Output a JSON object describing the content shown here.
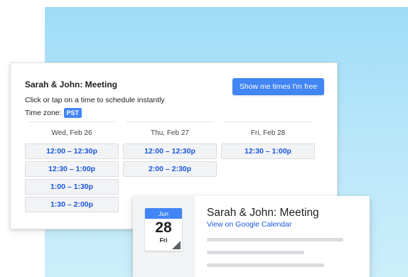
{
  "scheduler": {
    "title": "Sarah & John: Meeting",
    "instructions": "Click or tap on a time to schedule instantly",
    "timezone_label": "Time zone:",
    "timezone_value": "PST",
    "free_button_label": "Show me times I'm free",
    "days": [
      {
        "label": "Wed, Feb 26",
        "slots": [
          "12:00 – 12:30p",
          "12:30 – 1:00p",
          "1:00 – 1:30p",
          "1:30 – 2:00p"
        ]
      },
      {
        "label": "Thu, Feb 27",
        "slots": [
          "12:00 – 12:30p",
          "2:00 – 2:30p"
        ]
      },
      {
        "label": "Fri, Feb 28",
        "slots": [
          "12:30 – 1:00p"
        ]
      }
    ]
  },
  "event": {
    "month": "Jun",
    "day": "28",
    "weekday": "Fri",
    "title": "Sarah & John: Meeting",
    "link_label": "View on Google Calendar"
  },
  "colors": {
    "accent": "#4285f4",
    "link": "#1a56db",
    "background_gradient": [
      "#9fdcf6",
      "#cdeefb"
    ]
  }
}
